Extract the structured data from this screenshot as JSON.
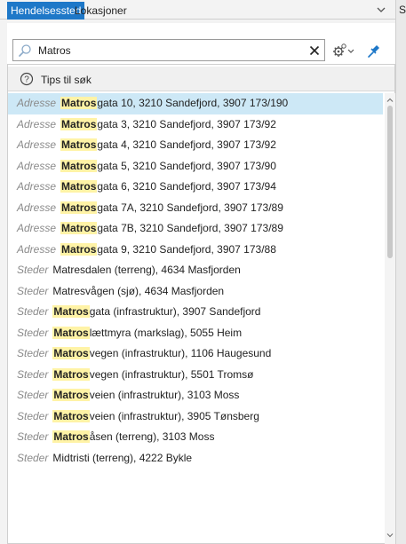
{
  "tabs": {
    "active_label": "Hendelsessted",
    "inactive_label": "Lokasjoner",
    "right_label": "S"
  },
  "search": {
    "value": "Matros",
    "placeholder": ""
  },
  "tips": {
    "label": "Tips til søk"
  },
  "icons": {
    "search": "search-icon",
    "clear": "close-icon",
    "settings": "gear-icon",
    "pin": "pin-icon",
    "help": "help-icon",
    "tab_menu": "chevron-down-icon"
  },
  "colors": {
    "accent": "#1e78c8",
    "selected_row": "#cde8f6",
    "match_highlight": "#fff3a6"
  },
  "results": [
    {
      "type": "Adresse",
      "match": "Matros",
      "rest": "gata 10, 3210 Sandefjord, 3907 173/190",
      "selected": true
    },
    {
      "type": "Adresse",
      "match": "Matros",
      "rest": "gata 3, 3210 Sandefjord, 3907 173/92",
      "selected": false
    },
    {
      "type": "Adresse",
      "match": "Matros",
      "rest": "gata 4, 3210 Sandefjord, 3907 173/92",
      "selected": false
    },
    {
      "type": "Adresse",
      "match": "Matros",
      "rest": "gata 5, 3210 Sandefjord, 3907 173/90",
      "selected": false
    },
    {
      "type": "Adresse",
      "match": "Matros",
      "rest": "gata 6, 3210 Sandefjord, 3907 173/94",
      "selected": false
    },
    {
      "type": "Adresse",
      "match": "Matros",
      "rest": "gata 7A, 3210 Sandefjord, 3907 173/89",
      "selected": false
    },
    {
      "type": "Adresse",
      "match": "Matros",
      "rest": "gata 7B, 3210 Sandefjord, 3907 173/89",
      "selected": false
    },
    {
      "type": "Adresse",
      "match": "Matros",
      "rest": "gata 9, 3210 Sandefjord, 3907 173/88",
      "selected": false
    },
    {
      "type": "Steder",
      "match": "",
      "rest": "Matresdalen (terreng), 4634 Masfjorden",
      "selected": false
    },
    {
      "type": "Steder",
      "match": "",
      "rest": "Matresvågen (sjø), 4634 Masfjorden",
      "selected": false
    },
    {
      "type": "Steder",
      "match": "Matros",
      "rest": "gata (infrastruktur), 3907 Sandefjord",
      "selected": false
    },
    {
      "type": "Steder",
      "match": "Matros",
      "rest": "lættmyra (markslag), 5055 Heim",
      "selected": false
    },
    {
      "type": "Steder",
      "match": "Matros",
      "rest": "vegen (infrastruktur), 1106 Haugesund",
      "selected": false
    },
    {
      "type": "Steder",
      "match": "Matros",
      "rest": "vegen (infrastruktur), 5501 Tromsø",
      "selected": false
    },
    {
      "type": "Steder",
      "match": "Matros",
      "rest": "veien (infrastruktur), 3103 Moss",
      "selected": false
    },
    {
      "type": "Steder",
      "match": "Matros",
      "rest": "veien (infrastruktur), 3905 Tønsberg",
      "selected": false
    },
    {
      "type": "Steder",
      "match": "Matros",
      "rest": "åsen (terreng), 3103 Moss",
      "selected": false
    },
    {
      "type": "Steder",
      "match": "",
      "rest": "Midtristi (terreng), 4222 Bykle",
      "selected": false
    }
  ]
}
